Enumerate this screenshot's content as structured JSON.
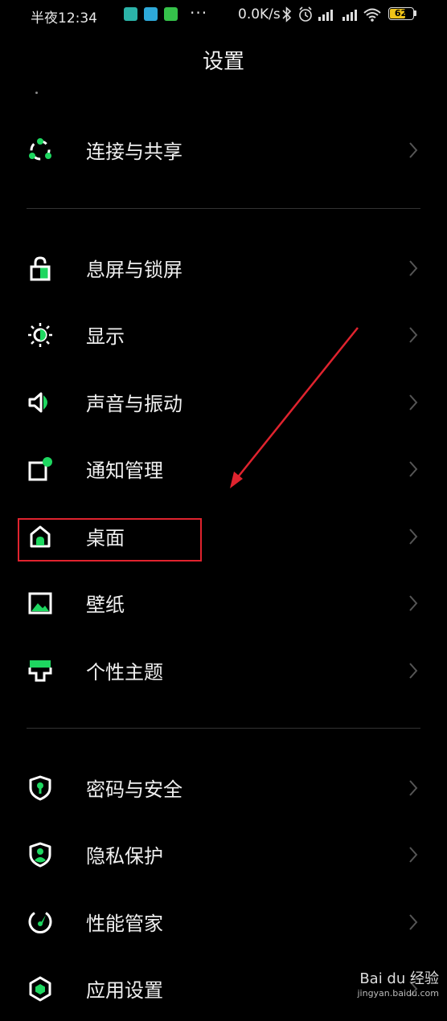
{
  "status_bar": {
    "time": "半夜12:34",
    "more_dots": "···",
    "net_speed": "0.0K/s",
    "battery_level": "62"
  },
  "header": {
    "title": "设置"
  },
  "settings": [
    {
      "label": "连接与共享",
      "icon": "share-icon"
    },
    {
      "label": "息屏与锁屏",
      "icon": "lock-icon"
    },
    {
      "label": "显示",
      "icon": "brightness-icon"
    },
    {
      "label": "声音与振动",
      "icon": "speaker-icon"
    },
    {
      "label": "通知管理",
      "icon": "notification-icon"
    },
    {
      "label": "桌面",
      "icon": "home-icon"
    },
    {
      "label": "壁纸",
      "icon": "wallpaper-icon"
    },
    {
      "label": "个性主题",
      "icon": "theme-icon"
    },
    {
      "label": "密码与安全",
      "icon": "shield-icon"
    },
    {
      "label": "隐私保护",
      "icon": "privacy-icon"
    },
    {
      "label": "性能管家",
      "icon": "gauge-icon"
    },
    {
      "label": "应用设置",
      "icon": "app-hex-icon"
    }
  ],
  "watermark": {
    "brand": "Bai du 经验",
    "url": "jingyan.baidu.com"
  },
  "colors": {
    "accent": "#1ed760",
    "highlight": "#e0232e",
    "background": "#000000"
  }
}
